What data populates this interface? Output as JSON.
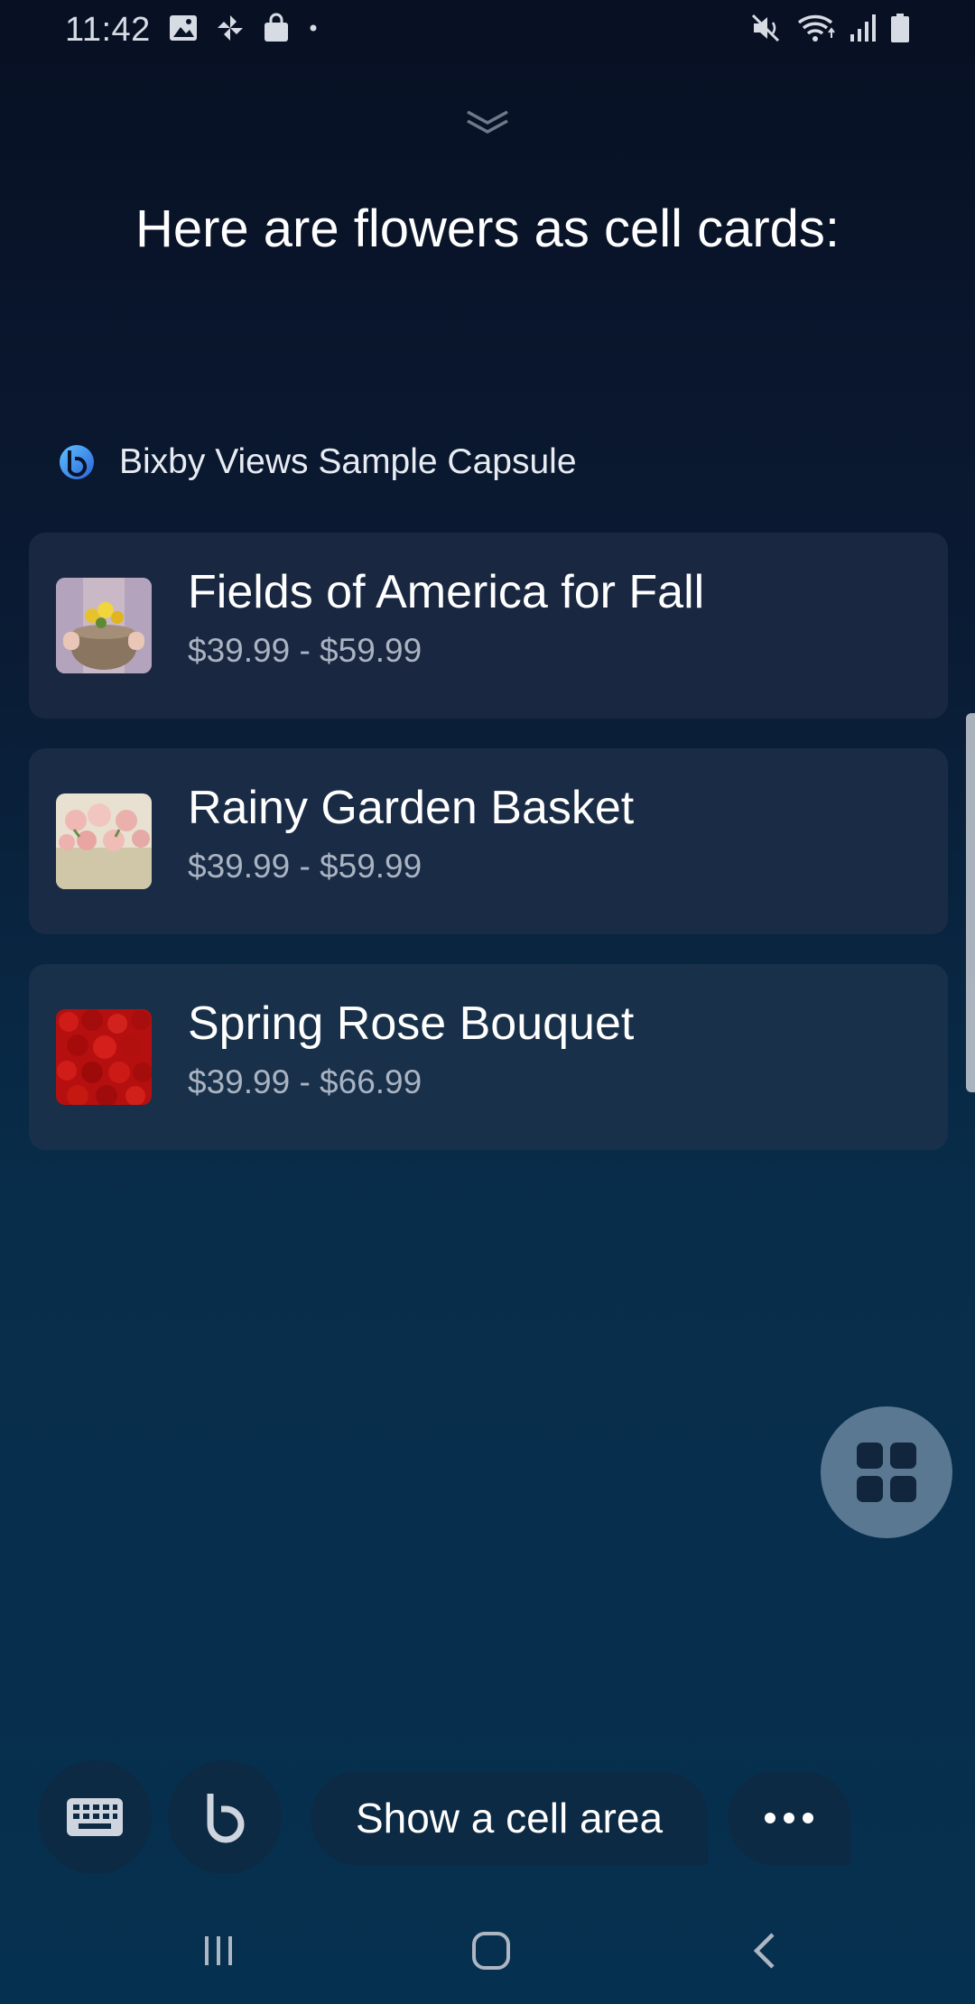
{
  "status_bar": {
    "time": "11:42",
    "left_icons": [
      "image-icon",
      "pinwheel-icon",
      "shopping-bag-icon",
      "dot-icon"
    ],
    "right_icons": [
      "mute-icon",
      "wifi-icon",
      "signal-icon",
      "battery-icon"
    ]
  },
  "header": {
    "title": "Here are flowers as cell cards:"
  },
  "capsule": {
    "name": "Bixby Views Sample Capsule",
    "icon": "bixby-logo-icon"
  },
  "cards": [
    {
      "title": "Fields of America for Fall",
      "price": "$39.99 - $59.99",
      "image": "flower-basket-photo"
    },
    {
      "title": "Rainy Garden Basket",
      "price": "$39.99 - $59.99",
      "image": "pink-roses-photo"
    },
    {
      "title": "Spring Rose Bouquet",
      "price": "$39.99 - $66.99",
      "image": "red-roses-photo"
    }
  ],
  "fab": {
    "icon": "grid-icon"
  },
  "bottom": {
    "keyboard_icon": "keyboard-icon",
    "bixby_icon": "bixby-icon",
    "suggestion": "Show a cell area",
    "more_icon": "more-icon"
  },
  "nav": {
    "icons": [
      "recents-icon",
      "home-icon",
      "back-icon"
    ]
  },
  "colors": {
    "background_top": "#081023",
    "background_bottom": "#06304f",
    "card": "#1a2b45",
    "price_text": "#a9b3c2",
    "fab": "#5a7891"
  }
}
